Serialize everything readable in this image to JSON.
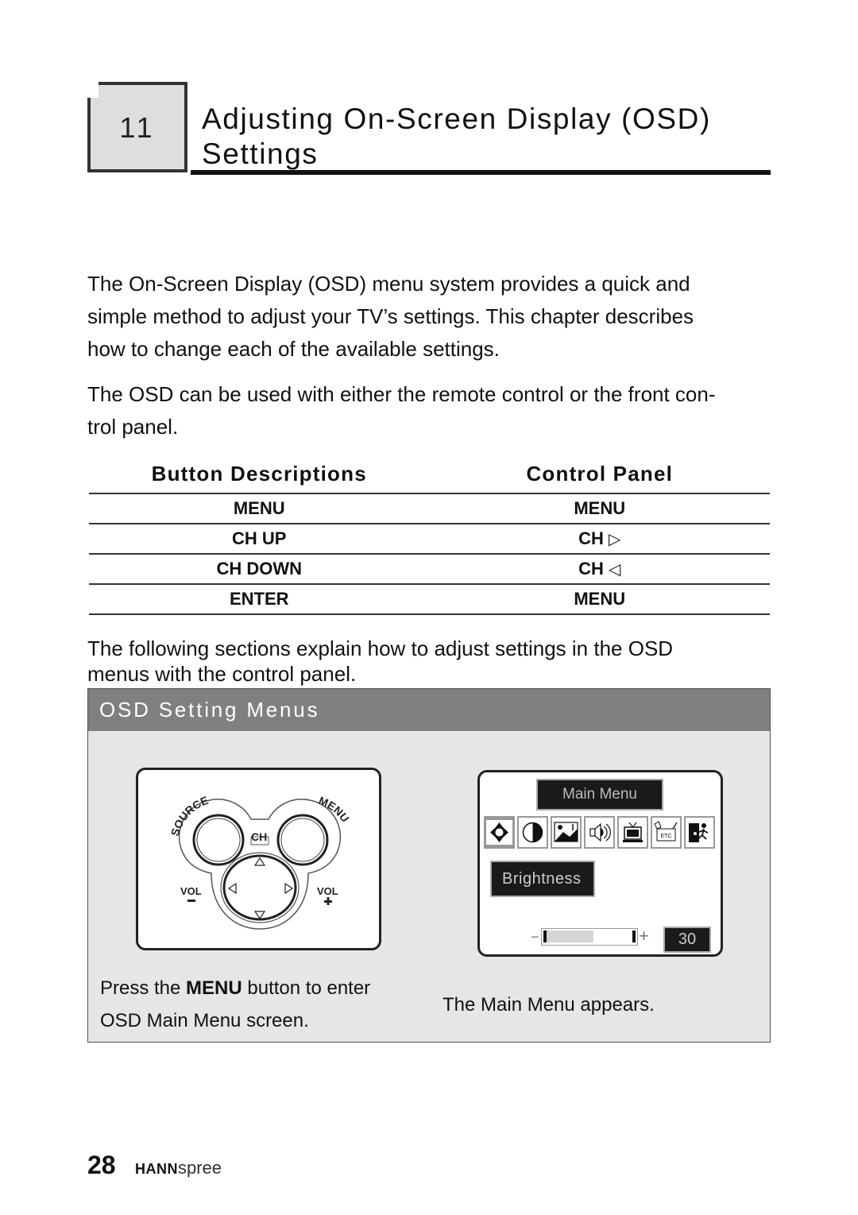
{
  "chapter": {
    "number": "11",
    "title_line1": "Adjusting On-Screen Display (OSD)",
    "title_line2": "Settings"
  },
  "intro": {
    "paragraph1": "The On-Screen Display (OSD) menu system provides a quick and simple method to adjust your TV’s settings. This chapter describes how to change each of the available settings.",
    "paragraph1_lines": [
      "The On-Screen Display (OSD) menu system provides a quick and",
      "simple method to adjust your TV’s settings. This chapter describes",
      "how to change each of the available settings."
    ],
    "paragraph2_lines": [
      "The OSD can be used with either the remote control or the front con-",
      "trol panel."
    ]
  },
  "button_table": {
    "headers": [
      "Button Descriptions",
      "Control Panel"
    ],
    "rows": [
      {
        "button": "MENU",
        "panel": "MENU",
        "panel_icon": ""
      },
      {
        "button": "CH UP",
        "panel": "CH",
        "panel_icon": "▷"
      },
      {
        "button": "CH DOWN",
        "panel": "CH",
        "panel_icon": "◁"
      },
      {
        "button": "ENTER",
        "panel": "MENU",
        "panel_icon": ""
      }
    ]
  },
  "following": {
    "lines": [
      "The following sections explain how to adjust settings in the OSD",
      "menus with the control panel."
    ]
  },
  "osd_section": {
    "title": "OSD Setting Menus",
    "control_panel": {
      "labels": {
        "source": "SOURCE",
        "menu": "MENU",
        "ch": "CH",
        "vol_minus": "VOL",
        "vol_plus": "VOL",
        "minus_sign": "−",
        "plus_sign": "+"
      }
    },
    "osd_screen": {
      "title": "Main Menu",
      "icons": [
        "brightness-icon",
        "contrast-icon",
        "picture-icon",
        "audio-icon",
        "tv-icon",
        "etc-icon",
        "exit-icon"
      ],
      "etc_label": "ETC",
      "selected_item": "Brightness",
      "slider_value": 30,
      "slider_fraction": 0.3,
      "value_display": "30",
      "minus": "−",
      "plus": "+"
    },
    "caption_left": {
      "pre": "Press the ",
      "bold": "MENU",
      "post": " button to enter",
      "line2": "OSD Main Menu screen."
    },
    "caption_right": "The Main Menu appears."
  },
  "footer": {
    "page_number": "28",
    "brand_bold": "HANN",
    "brand_light": "spree"
  }
}
